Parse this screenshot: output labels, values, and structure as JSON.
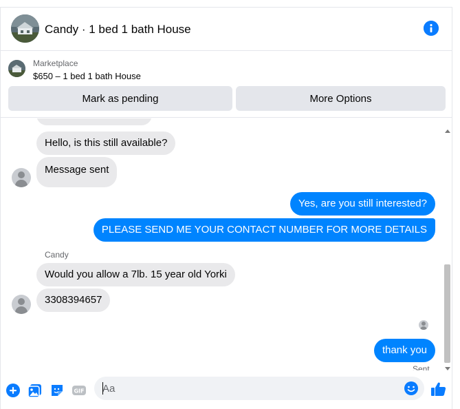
{
  "header": {
    "title": "Candy · 1 bed 1 bath House"
  },
  "marketplace": {
    "label": "Marketplace",
    "listing": "$650 – 1 bed 1 bath House",
    "mark_pending_label": "Mark as pending",
    "more_options_label": "More Options"
  },
  "messages": [
    {
      "direction": "in",
      "text": "Hello, is this still available?"
    },
    {
      "direction": "in",
      "text": "Message sent"
    },
    {
      "direction": "out",
      "text": "Yes, are you still interested?"
    },
    {
      "direction": "out",
      "text": "PLEASE SEND ME YOUR CONTACT NUMBER FOR MORE DETAILS"
    },
    {
      "direction": "in",
      "text": "Would you allow a 7lb. 15 year old Yorki"
    },
    {
      "direction": "in",
      "text": "3308394657"
    },
    {
      "direction": "out",
      "text": "thank you"
    }
  ],
  "chat": {
    "sender_name": "Candy",
    "last_status": "Sent"
  },
  "composer": {
    "placeholder": "Aa",
    "gif_label": "GIF"
  },
  "colors": {
    "accent": "#0084ff",
    "icon_blue": "#0a7cff",
    "incoming_bubble": "#e9e9eb",
    "button_bg": "#e4e6eb"
  },
  "icons": [
    "info-icon",
    "plus-icon",
    "image-icon",
    "sticker-icon",
    "gif-icon",
    "emoji-icon",
    "thumbs-up-icon",
    "avatar-icon",
    "seen-avatar-icon"
  ]
}
